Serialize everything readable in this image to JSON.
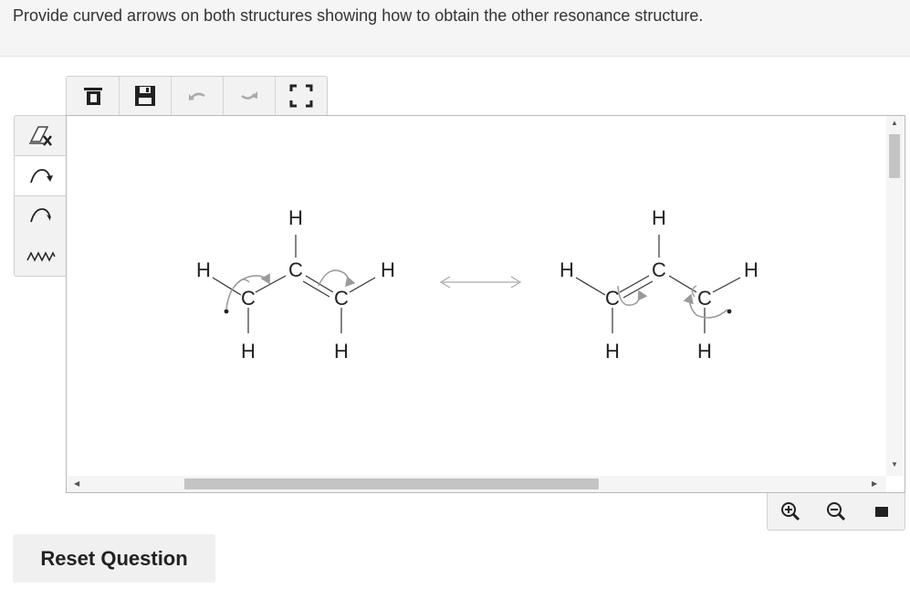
{
  "question": {
    "text": "Provide curved arrows on both structures showing how to obtain the other resonance structure."
  },
  "toolbar": {
    "items": [
      {
        "name": "clear-icon"
      },
      {
        "name": "save-icon"
      },
      {
        "name": "undo-icon"
      },
      {
        "name": "redo-icon"
      },
      {
        "name": "fullscreen-icon"
      }
    ]
  },
  "side_tools": {
    "items": [
      {
        "name": "eraser-icon"
      },
      {
        "name": "electron-pair-arrow-icon",
        "active": true
      },
      {
        "name": "single-electron-arrow-icon"
      },
      {
        "name": "bond-cleave-icon"
      }
    ]
  },
  "structure1": {
    "atoms": {
      "h_top": "H",
      "c_center": "C",
      "h_left": "H",
      "c_left": "C",
      "c_right": "C",
      "h_right": "H",
      "h_bottom_left": "H",
      "h_bottom_right": "H"
    }
  },
  "structure2": {
    "atoms": {
      "h_top": "H",
      "c_center": "C",
      "h_left": "H",
      "c_left": "C",
      "c_right": "C",
      "h_right": "H",
      "h_bottom_left": "H",
      "h_bottom_right": "H"
    }
  },
  "zoom_controls": {
    "items": [
      {
        "name": "zoom-in-icon"
      },
      {
        "name": "zoom-out-icon"
      },
      {
        "name": "fit-icon"
      }
    ]
  },
  "reset_label": "Reset Question",
  "colors": {
    "bond": "#333333",
    "curved_arrow": "#9a9a9a",
    "resonance_arrow": "#aaaaaa"
  }
}
